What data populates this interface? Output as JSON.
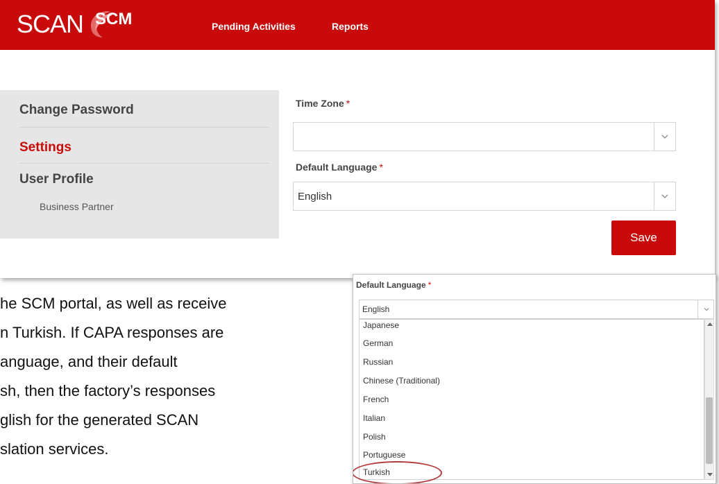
{
  "colors": {
    "brand_red": "#c80a0a",
    "sidebar_bg": "#e6e6e6",
    "highlight_circle": "#b23a3a"
  },
  "header": {
    "logo_scan": "SCAN",
    "logo_scm": "SCM",
    "logo_swoosh_icon": "red-swoosh-icon",
    "nav": [
      "Pending Activities",
      "Reports"
    ]
  },
  "sidebar": {
    "items": [
      "Change Password",
      "Settings",
      "User Profile"
    ],
    "sub_item": "Business Partner",
    "active": "Settings"
  },
  "form": {
    "time_zone_label": "Time Zone",
    "time_zone_value": "",
    "default_language_label": "Default Language",
    "default_language_value": "English",
    "required_mark": "*",
    "save_label": "Save"
  },
  "body_text": [
    "he SCM portal, as well as receive",
    "n Turkish. If CAPA responses are",
    "anguage, and their default",
    "sh, then the factory’s responses",
    "glish for the generated SCAN",
    "slation services."
  ],
  "dropdown": {
    "label": "Default Language",
    "required_mark": "*",
    "selected": "English",
    "options": [
      "Japanese",
      "German",
      "Russian",
      "Chinese (Traditional)",
      "French",
      "Italian",
      "Polish",
      "Portuguese",
      "Turkish"
    ],
    "highlighted_option": "Turkish"
  }
}
